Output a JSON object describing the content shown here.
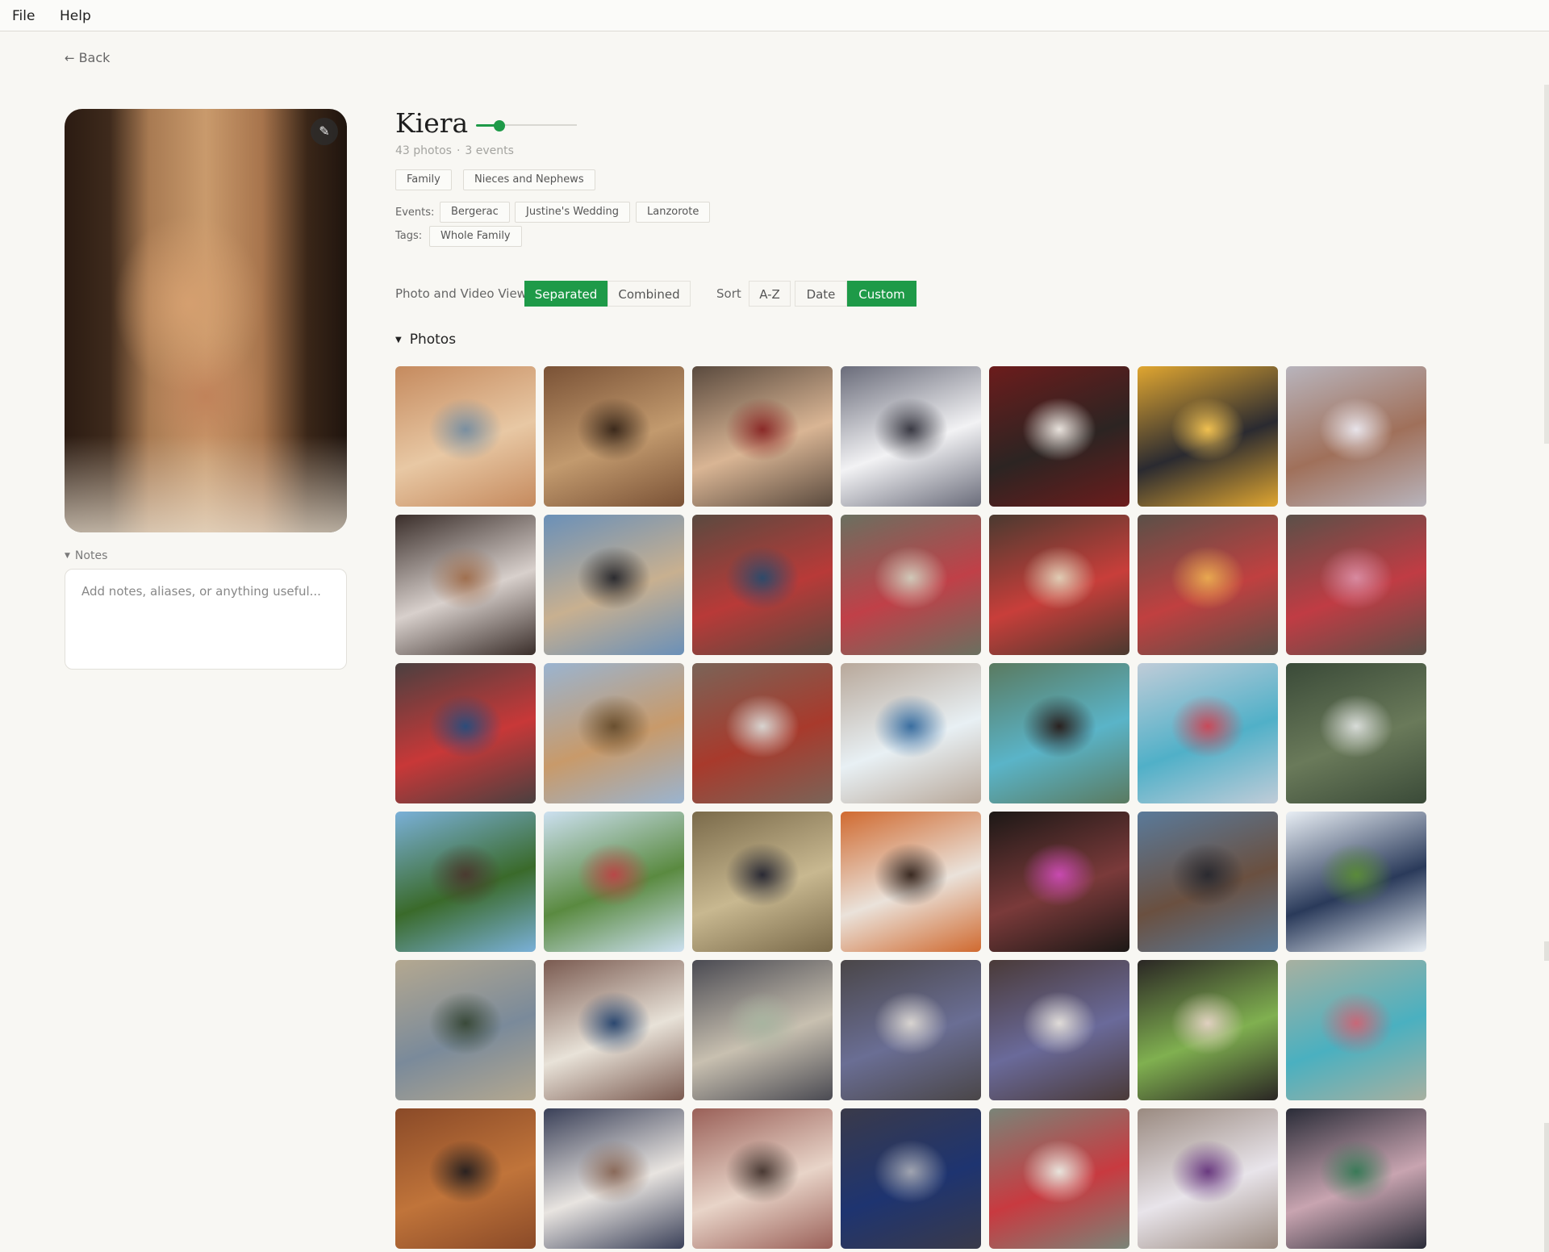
{
  "menu": {
    "file": "File",
    "help": "Help"
  },
  "back": {
    "arrow": "←",
    "label": "Back"
  },
  "person": {
    "name": "Kiera",
    "photos": "43 photos",
    "separator": "·",
    "events_count": "3 events",
    "groups": [
      "Family",
      "Nieces and Nephews"
    ],
    "events_label": "Events:",
    "events": [
      "Bergerac",
      "Justine's Wedding",
      "Lanzorote"
    ],
    "tags_label": "Tags:",
    "tags": [
      "Whole Family"
    ],
    "edit_icon": "✎"
  },
  "notes": {
    "label": "Notes",
    "placeholder": "Add notes, aliases, or anything useful..."
  },
  "controls": {
    "view_label": "Photo and Video View",
    "view_options": [
      "Separated",
      "Combined"
    ],
    "view_selected": "Separated",
    "sort_label": "Sort",
    "sort_options": [
      "A-Z",
      "Date",
      "Custom"
    ],
    "sort_selected": "Custom"
  },
  "section": {
    "title": "Photos",
    "toggle": "▼"
  },
  "accent_color": "#1e9a48",
  "photo_tints": [
    [
      "#c58a5e",
      "#e8c8a4",
      "#7a8fa0"
    ],
    [
      "#7a5236",
      "#c29a6e",
      "#3c2a1c"
    ],
    [
      "#5a4a3e",
      "#d9b594",
      "#8a2a28"
    ],
    [
      "#6a6c7a",
      "#f2f2f4",
      "#3a3a44"
    ],
    [
      "#6c1c1c",
      "#2c2422",
      "#e8e2dc"
    ],
    [
      "#e0a630",
      "#2a2a30",
      "#f0c050"
    ],
    [
      "#b8b4bc",
      "#a0705a",
      "#e8e4ea"
    ],
    [
      "#3a2e2a",
      "#d8d0cc",
      "#a07050"
    ],
    [
      "#6a90b8",
      "#c8b090",
      "#2c2c30"
    ],
    [
      "#5a4a40",
      "#b83a38",
      "#2e4a6a"
    ],
    [
      "#6a7060",
      "#c04048",
      "#d0c8b8"
    ],
    [
      "#4a3a30",
      "#c83e3a",
      "#e0ccb4"
    ],
    [
      "#5a5048",
      "#c04040",
      "#e8a850"
    ],
    [
      "#5a5048",
      "#c03c44",
      "#d88aa0"
    ],
    [
      "#4a4040",
      "#c83838",
      "#2c4c7a"
    ],
    [
      "#9ab4d0",
      "#c89a6a",
      "#6a5030"
    ],
    [
      "#7a6458",
      "#a83a2c",
      "#d8d4d0"
    ],
    [
      "#b8a89a",
      "#e8f0f4",
      "#3a6ea0"
    ],
    [
      "#5a7a60",
      "#5ab4c8",
      "#2a2220"
    ],
    [
      "#c0ccd8",
      "#50b0c8",
      "#c84a5a"
    ],
    [
      "#3a4a38",
      "#6a7a5a",
      "#d8dcd8"
    ],
    [
      "#7ab0d8",
      "#3a6a2a",
      "#4a3a30"
    ],
    [
      "#cce0f0",
      "#5a8a40",
      "#b84848"
    ],
    [
      "#7a6a4a",
      "#c8b890",
      "#2a2a34"
    ],
    [
      "#d06a30",
      "#eae2da",
      "#3a2a22"
    ],
    [
      "#1c1816",
      "#7a3a3a",
      "#c84ab0"
    ],
    [
      "#5a7a9a",
      "#6a5040",
      "#2a2a30"
    ],
    [
      "#e8eef4",
      "#2a3a5a",
      "#5a8a3a"
    ],
    [
      "#b4a890",
      "#7a8a9a",
      "#3a4a3a"
    ],
    [
      "#7a5a50",
      "#e8e2d8",
      "#2c4870"
    ],
    [
      "#4a4a52",
      "#c8c0b0",
      "#a8b4a0"
    ],
    [
      "#4a4648",
      "#6a6e94",
      "#d8d4d0"
    ],
    [
      "#4a3a38",
      "#6a6a9a",
      "#e0dcd8"
    ],
    [
      "#2a2624",
      "#80b050",
      "#e0d0c0"
    ],
    [
      "#a8b0a0",
      "#4ab0c0",
      "#c86878"
    ],
    [
      "#8a4a28",
      "#c0743a",
      "#2a2220"
    ],
    [
      "#3a4058",
      "#e8e4e0",
      "#8a6a5a"
    ],
    [
      "#9a6058",
      "#e8d4c8",
      "#4a3a34"
    ],
    [
      "#3a3a4a",
      "#1e3470",
      "#a0a4b0"
    ],
    [
      "#7a8478",
      "#c83a40",
      "#e8e4dc"
    ],
    [
      "#9a8a80",
      "#e8e4ea",
      "#6a3a80"
    ],
    [
      "#2a2c38",
      "#c8a4b0",
      "#3a7a58"
    ]
  ]
}
